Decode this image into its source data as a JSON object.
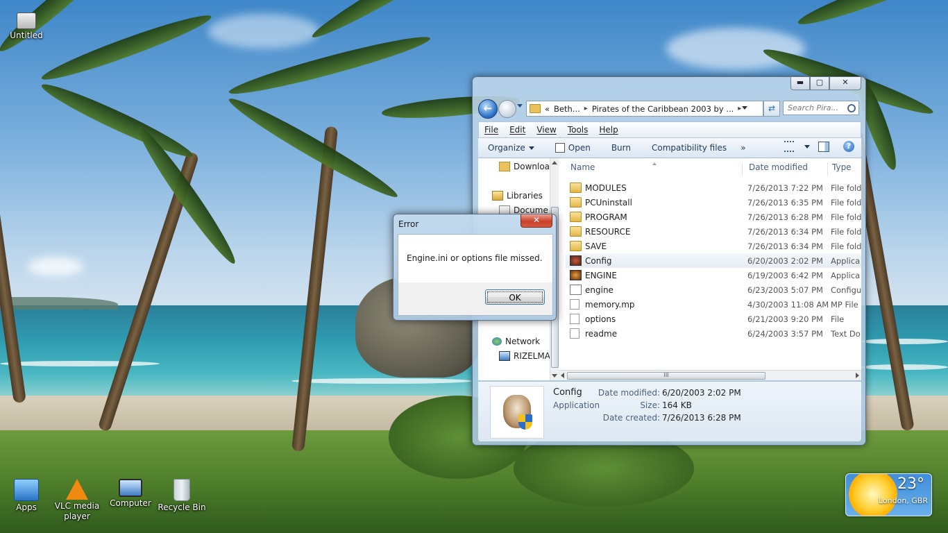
{
  "desktop": {
    "icons": [
      {
        "label": "Untitled"
      },
      {
        "label": "Apps"
      },
      {
        "label": "VLC media player"
      },
      {
        "label": "Computer"
      },
      {
        "label": "Recycle Bin"
      }
    ]
  },
  "explorer": {
    "window_controls": {
      "minimize": "▬",
      "maximize": "▢",
      "close": "✕"
    },
    "nav": {
      "back_icon": "back-arrow-icon",
      "forward_icon": "forward-arrow-icon"
    },
    "address": {
      "prefix": "«",
      "crumbs": [
        "Beth...",
        "Pirates of the Caribbean 2003 by ..."
      ],
      "separator": "▸"
    },
    "search_placeholder": "Search Pira...",
    "menu": [
      "File",
      "Edit",
      "View",
      "Tools",
      "Help"
    ],
    "toolbar": {
      "organize": "Organize",
      "open": "Open",
      "burn": "Burn",
      "compatibility": "Compatibility files",
      "more": "»",
      "help": "?"
    },
    "navpane": {
      "items": [
        {
          "label": "Downloa",
          "icon": "folder-icon"
        },
        {
          "label": "Libraries",
          "icon": "libraries-icon"
        },
        {
          "label": "Docume",
          "icon": "documents-icon"
        },
        {
          "label": "Network",
          "icon": "network-icon"
        },
        {
          "label": "RIZELMA",
          "icon": "computer-icon"
        }
      ]
    },
    "columns": {
      "name": "Name",
      "date": "Date modified",
      "type": "Type"
    },
    "files": [
      {
        "name": "MODULES",
        "date": "7/26/2013 7:22 PM",
        "type": "File fold",
        "icon": "folder"
      },
      {
        "name": "PCUninstall",
        "date": "7/26/2013 6:35 PM",
        "type": "File fold",
        "icon": "folder"
      },
      {
        "name": "PROGRAM",
        "date": "7/26/2013 6:28 PM",
        "type": "File fold",
        "icon": "folder"
      },
      {
        "name": "RESOURCE",
        "date": "7/26/2013 6:34 PM",
        "type": "File fold",
        "icon": "folder"
      },
      {
        "name": "SAVE",
        "date": "7/26/2013 6:34 PM",
        "type": "File fold",
        "icon": "folder"
      },
      {
        "name": "Config",
        "date": "6/20/2003 2:02 PM",
        "type": "Applica",
        "icon": "app",
        "selected": true
      },
      {
        "name": "ENGINE",
        "date": "6/19/2003 6:42 PM",
        "type": "Applica",
        "icon": "exe"
      },
      {
        "name": "engine",
        "date": "6/23/2003 5:07 PM",
        "type": "Configu",
        "icon": "cfg"
      },
      {
        "name": "memory.mp",
        "date": "4/30/2003 11:08 AM",
        "type": "MP File",
        "icon": "file"
      },
      {
        "name": "options",
        "date": "6/21/2003 9:20 PM",
        "type": "File",
        "icon": "file"
      },
      {
        "name": "readme",
        "date": "6/24/2003 3:57 PM",
        "type": "Text Do",
        "icon": "file"
      }
    ],
    "hscroll_grip": "III",
    "details": {
      "name": "Config",
      "type": "Application",
      "date_modified_label": "Date modified:",
      "date_modified": "6/20/2003 2:02 PM",
      "size_label": "Size:",
      "size": "164 KB",
      "date_created_label": "Date created:",
      "date_created": "7/26/2013 6:28 PM"
    }
  },
  "dialog": {
    "title": "Error",
    "close": "✕",
    "message": "Engine.ini or options file missed.",
    "ok": "OK"
  },
  "weather": {
    "temperature": "23°",
    "location": "London, GBR"
  }
}
